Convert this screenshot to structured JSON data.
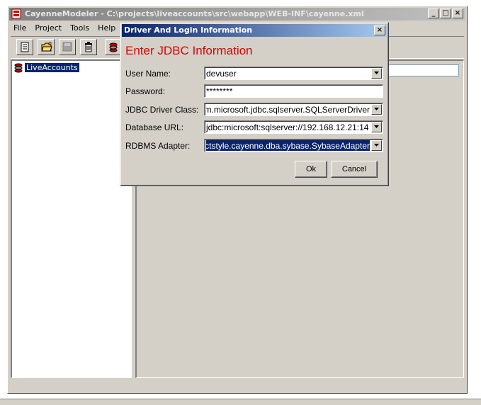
{
  "window": {
    "title": "CayenneModeler - C:\\projects\\liveaccounts\\src\\webapp\\WEB-INF\\cayenne.xml",
    "minimize": "_",
    "maximize": "□",
    "close": "×"
  },
  "menu": {
    "items": [
      {
        "label": "File"
      },
      {
        "label": "Project"
      },
      {
        "label": "Tools"
      },
      {
        "label": "Help"
      }
    ]
  },
  "tree": {
    "root_label": "LiveAccounts"
  },
  "dialog": {
    "title": "Driver And Login Information",
    "close": "×",
    "heading": "Enter JDBC Information",
    "fields": {
      "user_name": {
        "label": "User Name:",
        "value": "devuser"
      },
      "password": {
        "label": "Password:",
        "value": "********"
      },
      "driver_class": {
        "label": "JDBC Driver Class:",
        "value": "com.microsoft.jdbc.sqlserver.SQLServerDriver"
      },
      "database_url": {
        "label": "Database URL:",
        "value": "jdbc:microsoft:sqlserver://192.168.12.21:14"
      },
      "rdbms_adapter": {
        "label": "RDBMS Adapter:",
        "value": "org.objectstyle.cayenne.dba.sybase.SybaseAdapter"
      }
    },
    "ok_label": "Ok",
    "cancel_label": "Cancel"
  },
  "colors": {
    "heading": "#e00000",
    "selection": "#0a246a",
    "window_face": "#d4d0c8"
  }
}
